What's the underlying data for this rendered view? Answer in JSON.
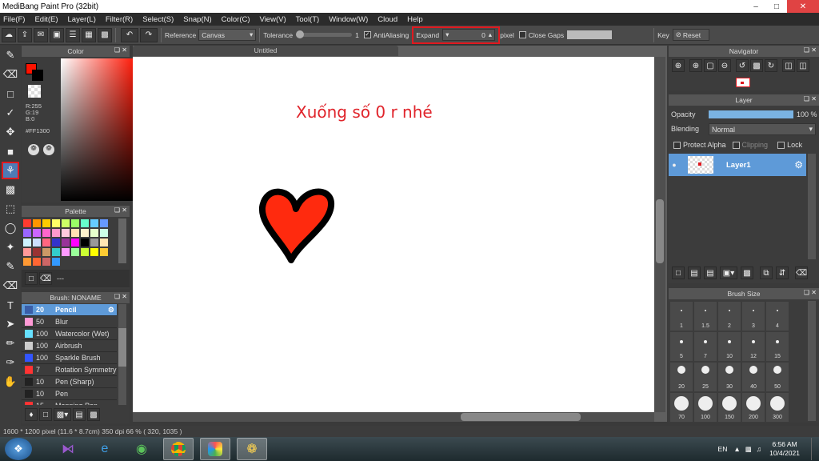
{
  "window": {
    "title": "MediBang Paint Pro (32bit)"
  },
  "menu": [
    "File(F)",
    "Edit(E)",
    "Layer(L)",
    "Filter(R)",
    "Select(S)",
    "Snap(N)",
    "Color(C)",
    "View(V)",
    "Tool(T)",
    "Window(W)",
    "Cloud",
    "Help"
  ],
  "toolbar": {
    "reference_label": "Reference",
    "reference_value": "Canvas",
    "tolerance_label": "Tolerance",
    "tolerance_value": "1",
    "antialiasing_label": "AntiAliasing",
    "expand_label": "Expand",
    "expand_value": "0",
    "expand_unit": "pixel",
    "close_gaps_label": "Close Gaps",
    "key_label": "Key",
    "reset_label": "Reset"
  },
  "color_panel": {
    "title": "Color",
    "r": "R:255",
    "g": "G:19",
    "b": "B:0",
    "hex": "#FF1300",
    "primary_color": "#ff1300"
  },
  "palette_panel": {
    "title": "Palette",
    "footer_text": "---",
    "swatches": [
      "#ff3b30",
      "#ff9500",
      "#ffcc00",
      "#ffff66",
      "#ccff66",
      "#99ff66",
      "#66ffcc",
      "#66ccff",
      "#6699ff",
      "#9966ff",
      "#cc66ff",
      "#ff66cc",
      "#ff99cc",
      "#ffccdd",
      "#ffe0b3",
      "#fff2cc",
      "#e6ffcc",
      "#ccffe6",
      "#ccf2ff",
      "#cce0ff",
      "#ff6680",
      "#3333cc",
      "#993399",
      "#ff00ff",
      "#000000",
      "#999999",
      "#ffe6b3",
      "#ff9999",
      "#993333",
      "#cc9966",
      "#33cccc",
      "#ff99ff",
      "#99ff99",
      "#ccff33",
      "#ffff00",
      "#ffcc33",
      "#ff9933",
      "#ff6633",
      "#cc6666",
      "#3399ff"
    ]
  },
  "brush_panel": {
    "title": "Brush: NONAME",
    "items": [
      {
        "size": "20",
        "name": "Pencil",
        "color": "#3a5ea8"
      },
      {
        "size": "50",
        "name": "Blur",
        "color": "#ff9ad6"
      },
      {
        "size": "100",
        "name": "Watercolor (Wet)",
        "color": "#66e0ff"
      },
      {
        "size": "100",
        "name": "Airbrush",
        "color": "#cccccc"
      },
      {
        "size": "100",
        "name": "Sparkle Brush",
        "color": "#3355ff"
      },
      {
        "size": "7",
        "name": "Rotation Symmetry",
        "color": "#ff3333"
      },
      {
        "size": "10",
        "name": "Pen (Sharp)",
        "color": "#222222"
      },
      {
        "size": "10",
        "name": "Pen",
        "color": "#222222"
      },
      {
        "size": "15",
        "name": "Mapping Pen",
        "color": "#ff3333"
      }
    ]
  },
  "canvas": {
    "tab_title": "Untitled",
    "annotation": "Xuống số 0 r nhé",
    "annotation_color": "#e0242b"
  },
  "navigator": {
    "title": "Navigator"
  },
  "layer_panel": {
    "title": "Layer",
    "opacity_label": "Opacity",
    "opacity_value": "100 %",
    "opacity_percent": 100,
    "blending_label": "Blending",
    "blending_value": "Normal",
    "protect_alpha_label": "Protect Alpha",
    "clipping_label": "Clipping",
    "lock_label": "Lock",
    "layer_name": "Layer1"
  },
  "brush_size_panel": {
    "title": "Brush Size",
    "sizes": [
      "1",
      "1.5",
      "2",
      "3",
      "4",
      "5",
      "7",
      "10",
      "12",
      "15",
      "20",
      "25",
      "30",
      "40",
      "50",
      "70",
      "100",
      "150",
      "200",
      "300"
    ]
  },
  "status": {
    "dimensions": "1600 * 1200 pixel",
    "physical": "(11.6 * 8.7cm)",
    "dpi": "350 dpi",
    "zoom": "66 %",
    "coords": "( 320, 1035 )"
  },
  "taskbar": {
    "lang": "EN",
    "time": "6:56 AM",
    "date": "10/4/2021"
  }
}
